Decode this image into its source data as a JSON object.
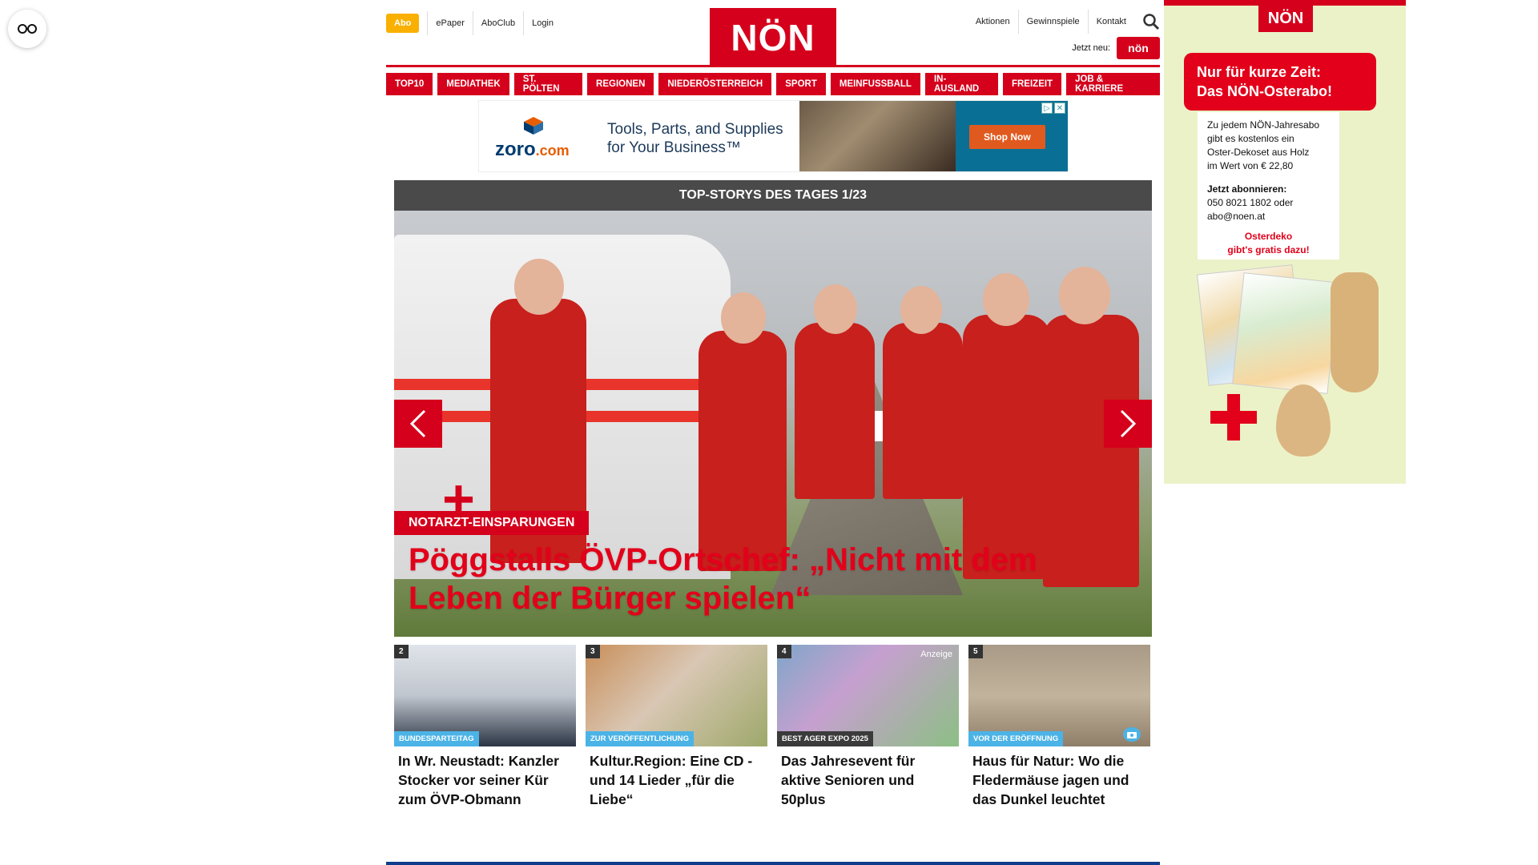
{
  "header": {
    "abo_label": "Abo",
    "left_links": [
      "ePaper",
      "AboClub",
      "Login"
    ],
    "logo_text": "NÖN",
    "right_links": [
      "Aktionen",
      "Gewinnspiele",
      "Kontakt"
    ],
    "jetzt_neu": "Jetzt neu:",
    "mini_logo_text": "nön"
  },
  "nav": [
    "TOP10",
    "MEDIATHEK",
    "ST. PÖLTEN",
    "REGIONEN",
    "NIEDERÖSTERREICH",
    "SPORT",
    "MEINFUSSBALL",
    "IN-AUSLAND",
    "FREIZEIT",
    "JOB & KARRIERE"
  ],
  "ad": {
    "brand": "zoro",
    "brand_suffix": ".com",
    "tagline_1": "Tools, Parts, and Supplies",
    "tagline_2": "for Your Business™",
    "cta": "Shop Now"
  },
  "stories": {
    "header": "TOP-STORYS DES TAGES 1/23",
    "hero": {
      "kicker": "NOTARZT-EINSPARUNGEN",
      "title": "Pöggstalls ÖVP-Ortschef: „Nicht mit dem Leben der Bürger spielen“"
    },
    "teasers": [
      {
        "num": "2",
        "badge": "BUNDESPARTEITAG",
        "title": "In Wr. Neustadt: Kanzler Stocker vor seiner Kür zum ÖVP-Obmann"
      },
      {
        "num": "3",
        "badge": "ZUR VERÖFFENTLICHUNG",
        "title": "Kultur.Region: Eine CD - und 14 Lieder „für die Liebe“"
      },
      {
        "num": "4",
        "badge": "BEST AGER EXPO 2025",
        "anzeige": "Anzeige",
        "title": "Das Jahresevent für aktive Senioren und 50plus"
      },
      {
        "num": "5",
        "badge": "VOR DER ERÖFFNUNG",
        "title": "Haus für Natur: Wo die Fledermäuse jagen und das Dunkel leuchtet"
      }
    ]
  },
  "side_ad": {
    "logo": "NÖN",
    "headline_1": "Nur für kurze Zeit:",
    "headline_2": "Das NÖN-Osterabo!",
    "body_1": "Zu jedem NÖN-Jahresabo",
    "body_2": "gibt es kostenlos ein",
    "body_3": "Oster-Dekoset aus Holz",
    "body_4": "im Wert von € 22,80",
    "cta_title": "Jetzt abonnieren:",
    "phone": "050 8021 1802 oder",
    "email": "abo@noen.at",
    "promo_1": "Osterdeko",
    "promo_2": "gibt's gratis dazu!"
  },
  "colors": {
    "brand_red": "#d5001c",
    "abo_yellow": "#f9b000",
    "badge_blue": "#4bb3e6"
  }
}
